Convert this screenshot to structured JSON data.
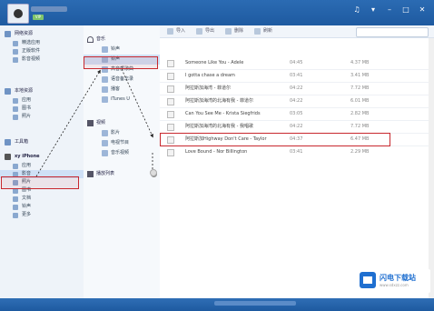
{
  "window": {
    "vip_badge": "VIP"
  },
  "title_icons": [
    "music-icon",
    "shirt-icon",
    "minimize-icon",
    "maximize-icon",
    "close-icon"
  ],
  "sidebar": {
    "sections": [
      {
        "name": "网络资源",
        "items": [
          "精选应用",
          "正版软件",
          "影音视频"
        ]
      },
      {
        "name": "本地资源",
        "items": [
          "应用",
          "图书",
          "照片"
        ]
      },
      {
        "name": "工具箱",
        "items": []
      },
      {
        "name": "xy iPhone",
        "items": [
          "应用",
          "影音",
          "照片",
          "图书",
          "文档",
          "铃声",
          "更多"
        ]
      }
    ],
    "active_item": "影音"
  },
  "midpane": {
    "groups": [
      {
        "name": "音乐",
        "items": [
          "铃声",
          "铃声",
          "高音质歌曲",
          "语音备忘录",
          "播客",
          "iTunes U"
        ]
      },
      {
        "name": "视频",
        "items": [
          "影片",
          "电视节目",
          "音乐视频"
        ]
      },
      {
        "name": "播放列表",
        "items": []
      }
    ],
    "active_item": "铃声"
  },
  "toolbar": {
    "import_label": "导入",
    "export_label": "导出",
    "delete_label": "删除",
    "refresh_label": "刷新"
  },
  "songs": [
    {
      "title": "Someone Like You - Adele",
      "duration": "04:45",
      "size": "4.37 MB"
    },
    {
      "title": "I gotta chase a dream",
      "duration": "03:41",
      "size": "3.41 MB"
    },
    {
      "title": "阿拉斯加海湾 - 菲道尔",
      "duration": "04:22",
      "size": "7.72 MB"
    },
    {
      "title": "阿拉斯加海湾的北海有我 - 菲道尔",
      "duration": "04:22",
      "size": "6.01 MB"
    },
    {
      "title": "Can You See Me - Krista Siegfrids",
      "duration": "03:05",
      "size": "2.82 MB"
    },
    {
      "title": "阿拉斯加海湾的北海有我 - 我唱歌",
      "duration": "04:22",
      "size": "7.72 MB"
    },
    {
      "title": "阿拉斯加Highway Don't Care - Taylor",
      "duration": "04:37",
      "size": "6.47 MB"
    },
    {
      "title": "Love Bound - Nor Billington",
      "duration": "03:41",
      "size": "2.29 MB"
    }
  ],
  "highlighted_song": "Love Bound - Nor Billington",
  "logo": {
    "name": "闪电下载站",
    "url": "www.sdxzz.com"
  },
  "colors": {
    "title_bar": "#1e5aa0",
    "highlight": "#c8282e",
    "active_bg": "#cfe0f6"
  }
}
